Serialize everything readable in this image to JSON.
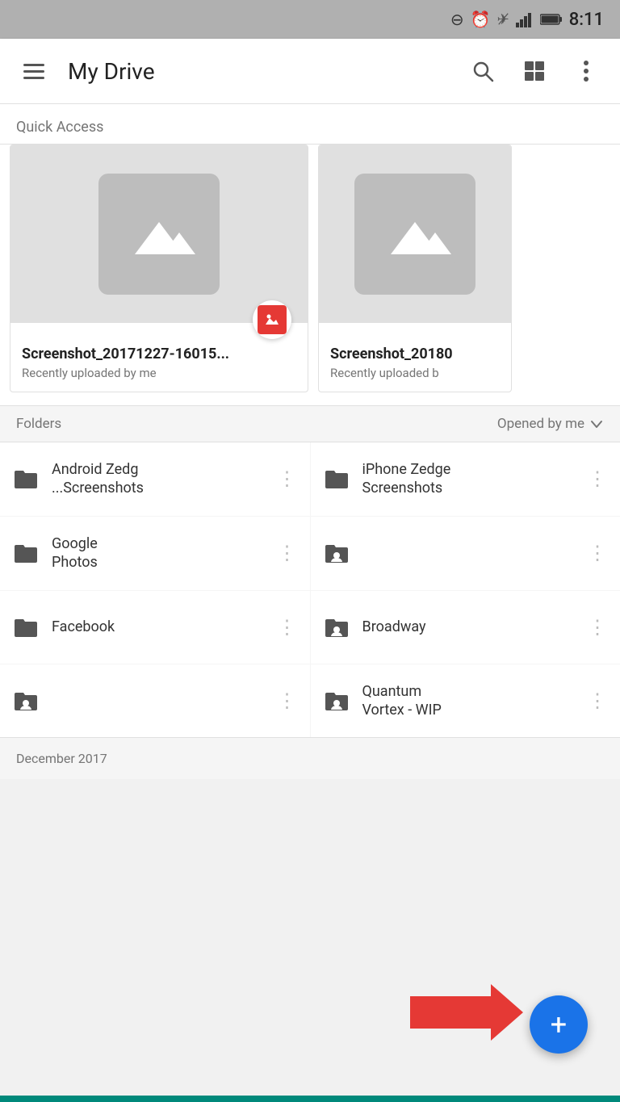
{
  "statusBar": {
    "time": "8:11",
    "icons": [
      "minus-circle",
      "alarm",
      "airplane-off",
      "signal",
      "battery"
    ]
  },
  "appBar": {
    "menuIcon": "hamburger-icon",
    "title": "My Drive",
    "searchIcon": "search-icon",
    "viewIcon": "grid-view-icon",
    "moreIcon": "more-vert-icon"
  },
  "quickAccess": {
    "label": "Quick Access",
    "cards": [
      {
        "name": "Screenshot_20171227-16015...",
        "sub": "Recently uploaded by me",
        "hasBadge": true
      },
      {
        "name": "Screenshot_20180",
        "sub": "Recently uploaded b",
        "hasBadge": false
      }
    ]
  },
  "foldersSection": {
    "label": "Folders",
    "sortLabel": "Opened by me",
    "sortIcon": "arrow-down-icon",
    "folders": [
      {
        "id": "android-zedg",
        "name": "Android Zedg\n...Screenshots",
        "type": "folder",
        "shared": false
      },
      {
        "id": "iphone-zedge",
        "name": "iPhone Zedge\nScreenshots",
        "type": "folder",
        "shared": false
      },
      {
        "id": "google-photos",
        "name": "Google\nPhotos",
        "type": "folder",
        "shared": false
      },
      {
        "id": "shared-empty-1",
        "name": "",
        "type": "shared-folder",
        "shared": true
      },
      {
        "id": "facebook",
        "name": "Facebook",
        "type": "folder",
        "shared": false
      },
      {
        "id": "broadway",
        "name": "Broadway",
        "type": "shared-folder",
        "shared": true
      },
      {
        "id": "shared-empty-2",
        "name": "",
        "type": "shared-folder",
        "shared": true
      },
      {
        "id": "quantum-vortex",
        "name": "Quantum\nVortex - WIP",
        "type": "shared-folder",
        "shared": true
      }
    ],
    "dateLabel": "December 2017"
  },
  "fab": {
    "label": "+",
    "icon": "plus-icon"
  }
}
